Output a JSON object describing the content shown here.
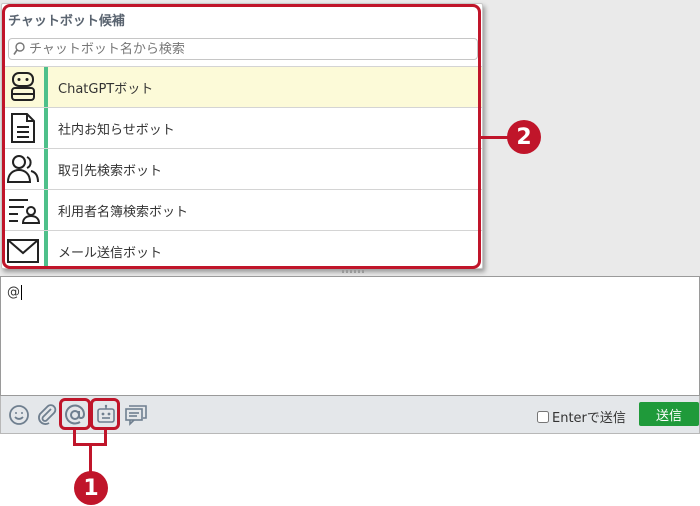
{
  "popup": {
    "title": "チャットボット候補",
    "search_placeholder": "チャットボット名から検索",
    "bots": [
      {
        "label": "ChatGPTボット",
        "icon": "robot-face-icon"
      },
      {
        "label": "社内お知らせボット",
        "icon": "document-icon"
      },
      {
        "label": "取引先検索ボット",
        "icon": "people-icon"
      },
      {
        "label": "利用者名簿検索ボット",
        "icon": "user-list-icon"
      },
      {
        "label": "メール送信ボット",
        "icon": "envelope-icon"
      }
    ],
    "selected_index": 0
  },
  "compose": {
    "text": "@"
  },
  "toolbar": {
    "tools": [
      "emoji-icon",
      "attachment-icon",
      "mention-icon",
      "bot-icon",
      "comment-icon"
    ],
    "enter_to_send_label": "Enterで送信",
    "enter_to_send_checked": false,
    "send_label": "送信"
  },
  "callouts": {
    "one": "1",
    "two": "2"
  },
  "colors": {
    "annotation": "#c0152a",
    "accent": "#4ec08a",
    "send": "#1f9a3a",
    "selected_row": "#fcfad8"
  }
}
